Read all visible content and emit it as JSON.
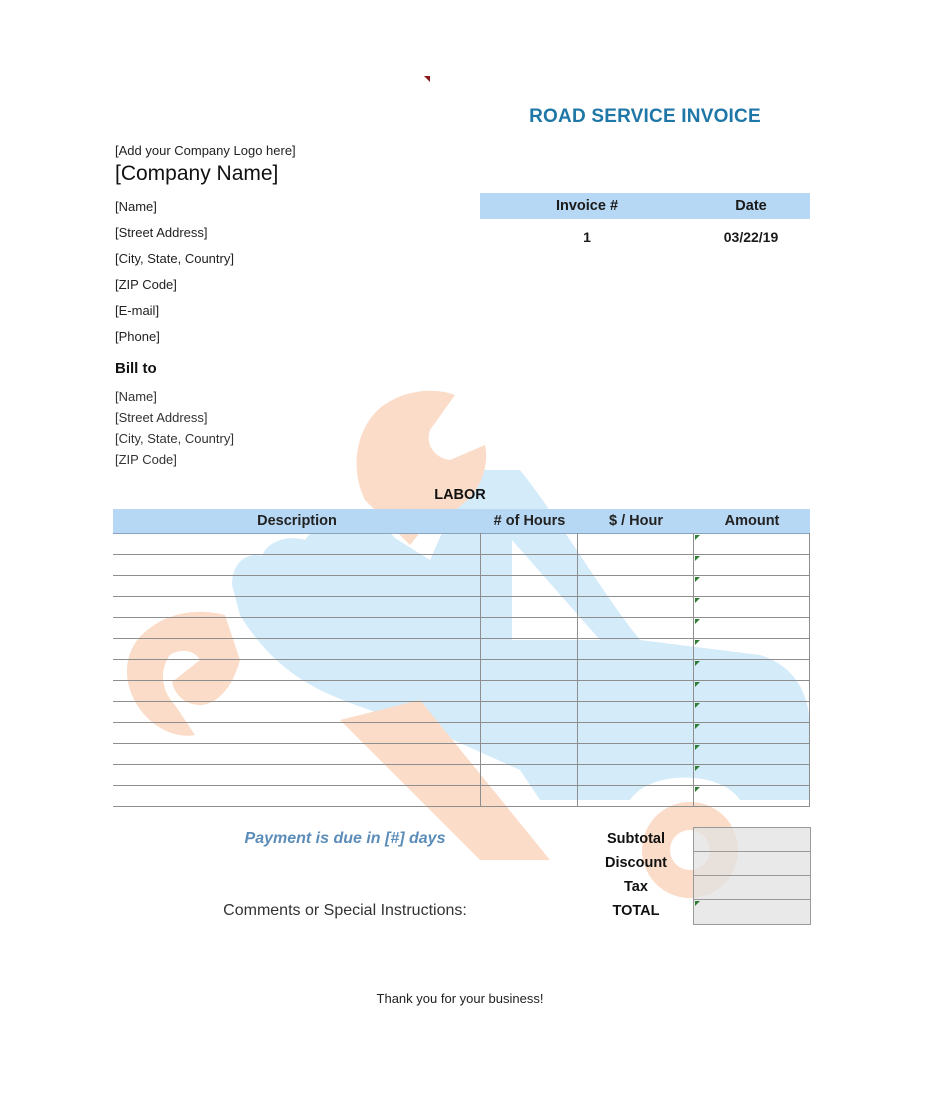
{
  "document": {
    "title": "ROAD SERVICE INVOICE",
    "logo_placeholder": "[Add your Company Logo here]",
    "company_name": "[Company Name]"
  },
  "sender": {
    "lines": [
      "[Name]",
      "[Street Address]",
      "[City, State, Country]",
      "[ZIP Code]",
      "[E-mail]",
      "[Phone]"
    ]
  },
  "bill_to": {
    "heading": "Bill to",
    "lines": [
      "[Name]",
      "[Street Address]",
      "[City, State, Country]",
      "[ZIP Code]"
    ]
  },
  "invoice_meta": {
    "headers": [
      "Invoice #",
      "Date"
    ],
    "values": [
      "1",
      "03/22/19"
    ]
  },
  "labor": {
    "heading": "LABOR",
    "columns": [
      "Description",
      "# of Hours",
      "$ / Hour",
      "Amount"
    ],
    "row_count": 13,
    "rows": [
      [
        "",
        "",
        "",
        ""
      ],
      [
        "",
        "",
        "",
        ""
      ],
      [
        "",
        "",
        "",
        ""
      ],
      [
        "",
        "",
        "",
        ""
      ],
      [
        "",
        "",
        "",
        ""
      ],
      [
        "",
        "",
        "",
        ""
      ],
      [
        "",
        "",
        "",
        ""
      ],
      [
        "",
        "",
        "",
        ""
      ],
      [
        "",
        "",
        "",
        ""
      ],
      [
        "",
        "",
        "",
        ""
      ],
      [
        "",
        "",
        "",
        ""
      ],
      [
        "",
        "",
        "",
        ""
      ],
      [
        "",
        "",
        "",
        ""
      ]
    ]
  },
  "footer": {
    "payment_due": "Payment is due in [#] days",
    "comments_label": "Comments or Special Instructions:",
    "thank_you": "Thank you for your business!"
  },
  "totals": {
    "labels": [
      "Subtotal",
      "Discount",
      "Tax",
      "TOTAL"
    ],
    "values": [
      "",
      "",
      "",
      ""
    ]
  },
  "colors": {
    "title": "#1f77a8",
    "header_fill": "#b7d8f4",
    "payment_due_text": "#5b8db8",
    "watermark_blue": "#d4ebfa",
    "watermark_orange": "#fbdcc8",
    "totals_fill": "#e6e6e6",
    "cell_marker": "#2f7d32"
  },
  "watermark": {
    "icon": "tow-truck-with-wrench-icon"
  }
}
